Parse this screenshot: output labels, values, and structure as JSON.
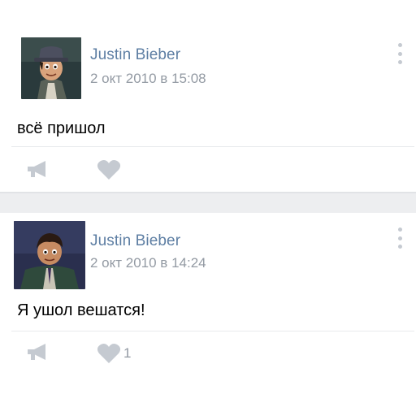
{
  "posts": [
    {
      "author": "Justin Bieber",
      "date": "2 окт 2010 в 15:08",
      "text": "всё пришол",
      "avatar_icon": "cartoon-boy-with-hat-avatar",
      "likes": ""
    },
    {
      "author": "Justin Bieber",
      "date": "2 окт 2010 в 14:24",
      "text": "Я ушол вешатся!",
      "avatar_icon": "cartoon-boy-in-jacket-avatar",
      "likes": "1"
    }
  ],
  "colors": {
    "author": "#5d7ea3",
    "muted": "#939aa3",
    "icon": "#c5cad1",
    "separator": "#edeef0"
  }
}
